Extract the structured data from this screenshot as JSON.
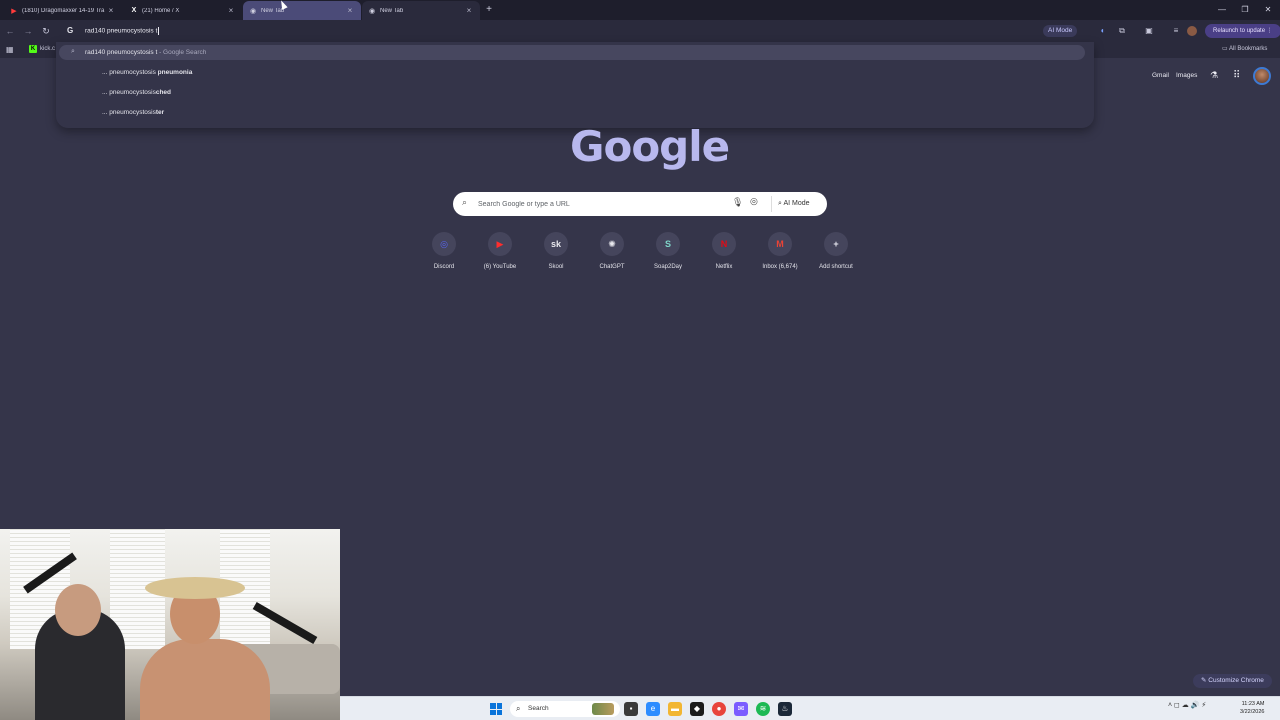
{
  "tabs": [
    {
      "label": "(1810) Dragomaxxer 14-19 Tra",
      "icon": "youtube-icon"
    },
    {
      "label": "(21) Home / X",
      "icon": "x-icon"
    },
    {
      "label": "New Tab",
      "icon": "chrome-icon"
    },
    {
      "label": "New Tab",
      "icon": "chrome-icon"
    }
  ],
  "toolbar": {
    "omnibox_value": "rad140 pneumocystosis t",
    "ai_mode": "AI Mode",
    "relaunch": "Relaunch to update"
  },
  "bookmarks": {
    "kick": "kick.c",
    "all": "All Bookmarks"
  },
  "dropdown": {
    "first": {
      "query": "rad140 pneumocystosis t",
      "suffix": " - Google Search"
    },
    "suggestions": [
      {
        "prefix": "... pneumocystosis ",
        "bold": "pneumonia"
      },
      {
        "prefix": "... pneumocystosis",
        "bold": "ched"
      },
      {
        "prefix": "... pneumocystosis",
        "bold": "ter"
      }
    ]
  },
  "header": {
    "gmail": "Gmail",
    "images": "Images"
  },
  "logo": "Google",
  "search": {
    "placeholder": "Search Google or type a URL",
    "ai_mode": "AI Mode"
  },
  "shortcuts": [
    {
      "label": "Discord",
      "glyph": "◎",
      "color": "#5865f2"
    },
    {
      "label": "(6) YouTube",
      "glyph": "▶",
      "color": "#ff2d2d"
    },
    {
      "label": "Skool",
      "glyph": "sk",
      "color": "#e9e9ee"
    },
    {
      "label": "ChatGPT",
      "glyph": "✺",
      "color": "#e9e9ee"
    },
    {
      "label": "Soap2Day",
      "glyph": "S",
      "color": "#7ed6c9"
    },
    {
      "label": "Netflix",
      "glyph": "N",
      "color": "#e50914"
    },
    {
      "label": "Inbox (6,674)",
      "glyph": "M",
      "color": "#ea4335"
    },
    {
      "label": "Add shortcut",
      "glyph": "+",
      "color": "#ececf4"
    }
  ],
  "customize": "Customize Chrome",
  "taskbar": {
    "search": "Search",
    "time": "11:23 AM",
    "date": "3/22/2026"
  }
}
